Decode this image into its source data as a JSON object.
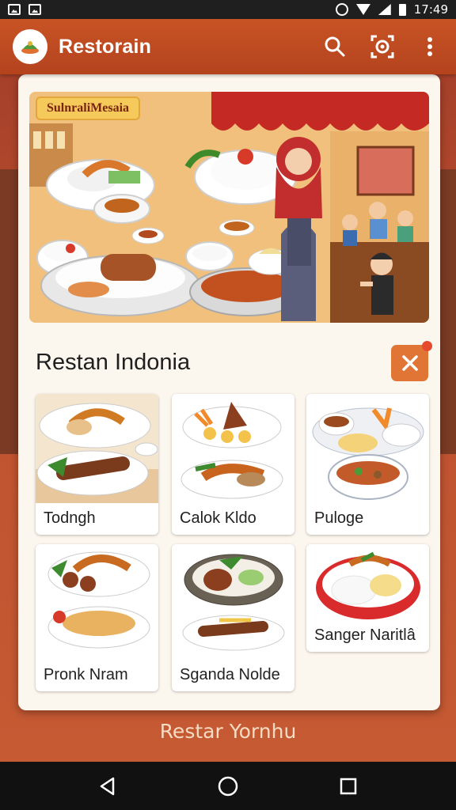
{
  "status_bar": {
    "time": "17:49"
  },
  "app_bar": {
    "title": "Restorain"
  },
  "hero": {
    "badge": "SulnraliMesaia"
  },
  "section": {
    "title": "Restan Indonia"
  },
  "dishes": [
    {
      "name": "Todngh"
    },
    {
      "name": "Calok Kldo"
    },
    {
      "name": "Puloge"
    },
    {
      "name": "Pronk Nram"
    },
    {
      "name": "Sganda Nolde"
    },
    {
      "name": "Sanger Naritlâ"
    }
  ],
  "footer": {
    "text": "Restar Yornhu"
  },
  "colors": {
    "primary": "#c04c21",
    "accent": "#e07536",
    "card": "#fbf6ee"
  },
  "icons": [
    "image-icon",
    "photo-icon",
    "alarm-icon",
    "wifi-icon",
    "signal-icon",
    "battery-icon",
    "search-icon",
    "camera-scan-icon",
    "more-vert-icon",
    "close-icon",
    "back-icon",
    "home-icon",
    "recents-icon"
  ]
}
